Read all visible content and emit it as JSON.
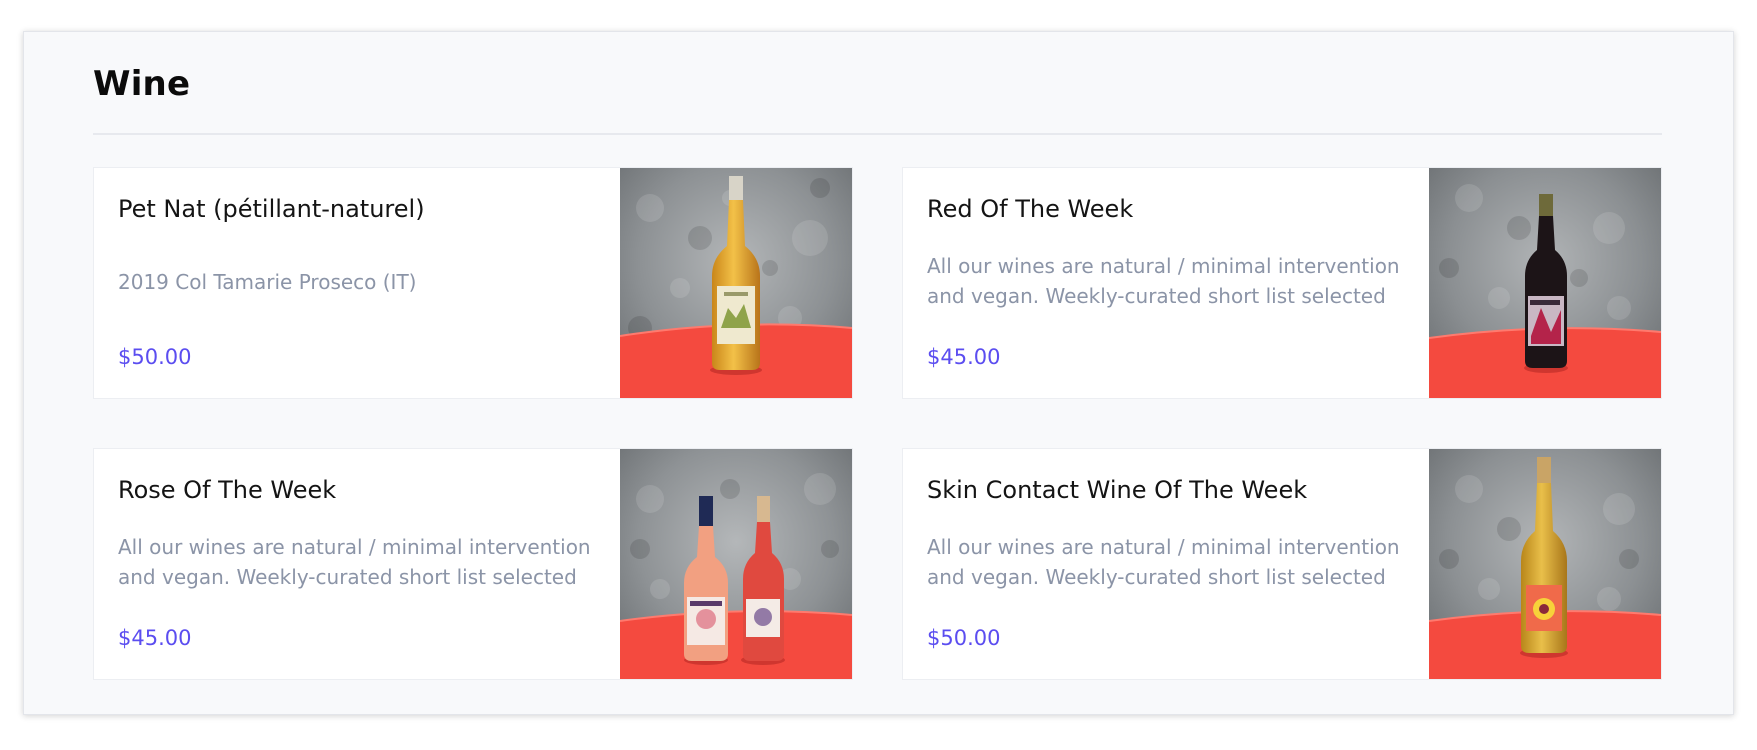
{
  "section": {
    "title": "Wine"
  },
  "items": [
    {
      "title": "Pet Nat (pétillant-naturel)",
      "description": "2019 Col Tamarie Proseco (IT)",
      "price": "$50.00",
      "image_icon": "white-wine-bottle-photo"
    },
    {
      "title": "Red Of The Week",
      "description": "All our wines are natural / minimal intervention and vegan. Weekly-curated short list selected",
      "price": "$45.00",
      "image_icon": "red-wine-bottle-photo"
    },
    {
      "title": "Rose Of The Week",
      "description": "All our wines are natural / minimal intervention and vegan. Weekly-curated short list selected",
      "price": "$45.00",
      "image_icon": "rose-wine-bottles-photo"
    },
    {
      "title": "Skin Contact Wine Of The Week",
      "description": "All our wines are natural / minimal intervention and vegan. Weekly-curated short list selected",
      "price": "$50.00",
      "image_icon": "skin-contact-wine-bottle-photo"
    }
  ],
  "colors": {
    "price": "#5b4df0",
    "description": "#8b94a7",
    "table_red": "#f4473f",
    "wall_gray": "#8f9396"
  }
}
